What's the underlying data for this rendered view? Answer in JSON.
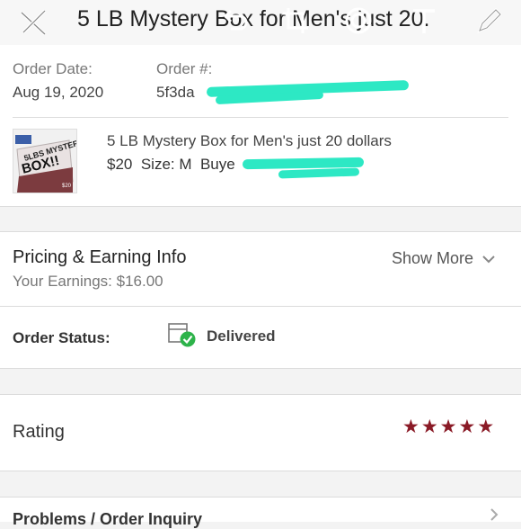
{
  "header": {
    "title": "5 LB Mystery Box for Men's just 20."
  },
  "order": {
    "date_label": "Order Date:",
    "date_value": "Aug 19, 2020",
    "number_label": "Order #:",
    "number_value": "5f3da"
  },
  "item": {
    "title": "5 LB Mystery Box for Men's just 20 dollars",
    "price": "$20",
    "size_label": "Size: M",
    "buyer_label": "Buye",
    "thumb_text_1": "5LBS MYSTERY",
    "thumb_text_2": "BOX!!",
    "thumb_price": "$20"
  },
  "pricing": {
    "title": "Pricing & Earning Info",
    "earnings": "Your Earnings: $16.00",
    "show_more": "Show More"
  },
  "status": {
    "label": "Order Status:",
    "value": "Delivered"
  },
  "rating": {
    "label": "Rating",
    "stars": 5
  },
  "problems": {
    "label": "Problems / Order Inquiry"
  },
  "colors": {
    "star": "#8a1a26",
    "delivered_check": "#2db34a",
    "redaction": "#2de8c4"
  }
}
